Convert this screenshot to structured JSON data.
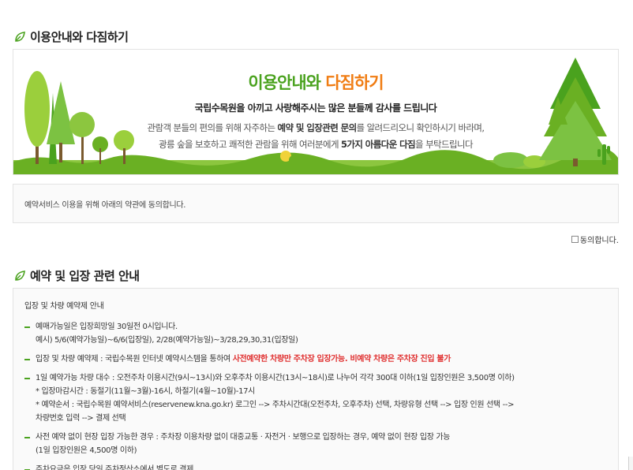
{
  "sections": {
    "guide_title": "이용안내와 다짐하기",
    "reservation_title": "예약 및 입장 관련 안내"
  },
  "banner": {
    "heading_green": "이용안내와 ",
    "heading_orange": "다짐하기",
    "subtitle": "국립수목원을 아끼고 사랑해주시는 많은 분들께 감사를 드립니다",
    "line1_a": "관람객 분들의 편의를 위해 자주하는 ",
    "line1_b": "예약 및 입장관련 문의",
    "line1_c": "를 알려드리오니 확인하시기 바라며,",
    "line2_a": "광릉 숲을 보호하고 쾌적한 관람을 위해 여러분에게 ",
    "line2_b": "5가지 아름다운 다짐",
    "line2_c": "을 부탁드립니다"
  },
  "agreement": {
    "text": "예약서비스 이용을 위해 아래의 약관에 동의합니다.",
    "checkbox_label": "동의합니다."
  },
  "info": {
    "heading": "입장 및 차량 예약제 안내",
    "item1_line1": "예매가능일은 입장희망일 30일전 0시입니다.",
    "item1_line2": "예시) 5/6(예약가능일)~6/6(입장일), 2/28(예약가능일)~3/28,29,30,31(입장일)",
    "item2_a": "입장 및 차량 예약제 : 국립수목원 인터넷 예약시스템을 통하여 ",
    "item2_b": "사전예약한 차량만 주차장 입장가능. 비예약 차량은 주차장 진입 불가",
    "item3_line1": "1일 예약가능 차량 대수 : 오전주차 이용시간(9시~13시)와 오후주차 이용시간(13시~18시)로 나누어 각각 300대 이하(1일 입장인원은 3,500명 이하)",
    "item3_line2": "* 입장마감시간 : 동절기(11월~3월)-16시, 하절기(4월~10월)-17시",
    "item3_line3": "* 예약순서 : 국립수목원 예약서비스(reservenew.kna.go.kr) 로그인 --> 주차시간대(오전주차, 오후주차) 선택, 차량유형 선택 --> 입장 인원 선택 -->",
    "item3_line4": "차량번호 입력 --> 결제 선택",
    "item4_line1": "사전 예약 없이 현장 입장 가능한 경우 : 주차장 이용차량 없이 대중교통 · 자전거 · 보행으로 입장하는 경우, 예약 없이 현장 입장 가능",
    "item4_line2": "(1일 입장인원은 4,500명 이하)",
    "item5_line1": "주차요금은 입장 당일 주차정산소에서 별도로 결제"
  },
  "colors": {
    "accent_green": "#4aa21e",
    "accent_orange": "#f07c12",
    "warning_red": "#e03030"
  }
}
